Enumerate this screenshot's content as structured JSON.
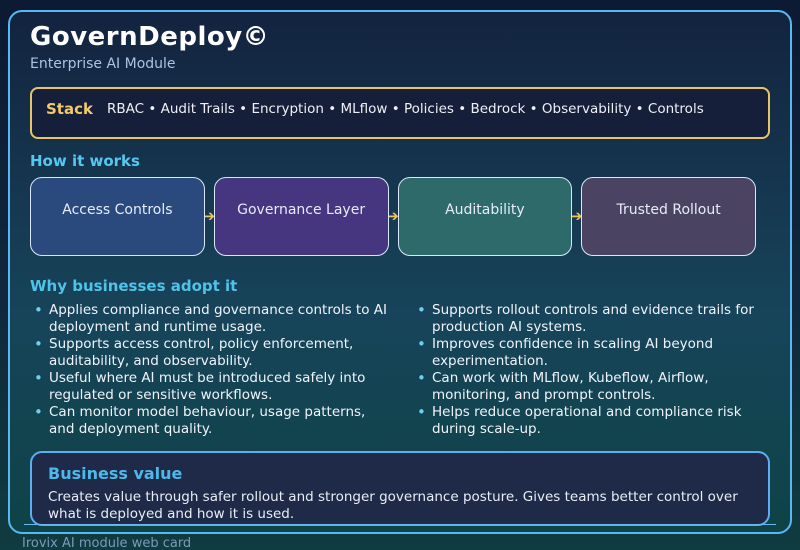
{
  "card": {
    "title": "GovernDeploy©",
    "subtitle": "Enterprise AI Module",
    "stack": {
      "label": "Stack",
      "items": "RBAC • Audit Trails • Encryption • MLflow • Policies • Bedrock • Observability • Controls"
    },
    "how_it_works": {
      "heading": "How it works",
      "steps": [
        {
          "label": "Access Controls",
          "color": "#2a4a7e"
        },
        {
          "label": "Governance Layer",
          "color": "#46357f"
        },
        {
          "label": "Auditability",
          "color": "#2e6a6a"
        },
        {
          "label": "Trusted Rollout",
          "color": "#4a4462"
        }
      ],
      "connector_icon": "➔"
    },
    "why": {
      "heading": "Why businesses adopt it",
      "left": [
        "Applies compliance and governance controls to AI deployment and runtime usage.",
        "Supports access control, policy enforcement, auditability, and observability.",
        "Useful where AI must be introduced safely into regulated or sensitive workflows.",
        "Can monitor model behaviour, usage patterns, and deployment quality."
      ],
      "right": [
        "Supports rollout controls and evidence trails for production AI systems.",
        "Improves confidence in scaling AI beyond experimentation.",
        "Can work with MLflow, Kubeflow, Airflow, monitoring, and prompt controls.",
        "Helps reduce operational and compliance risk during scale-up."
      ]
    },
    "business_value": {
      "heading": "Business value",
      "text": "Creates value through safer rollout and stronger governance posture. Gives teams better control over what is deployed and how it is used."
    }
  },
  "footer": {
    "caption": "Irovix AI module web card"
  },
  "colors": {
    "page_bg_top": "#0c1a33",
    "page_bg_bottom": "#0f3c40",
    "card_border": "#5ab7f2",
    "card_bg_top": "#13233f",
    "card_bg_bottom": "#0e4347",
    "stack_border": "#e9c464",
    "stack_label": "#f2ca6a",
    "stack_bg": "#161f3a",
    "heading_cyan": "#56c8f0",
    "bullet_dot": "#6ed0f0",
    "arrow_gold": "#eec05e",
    "business_bg": "#1e2a48",
    "business_border": "#5fadf0",
    "footer_text": "#7e99bb"
  }
}
